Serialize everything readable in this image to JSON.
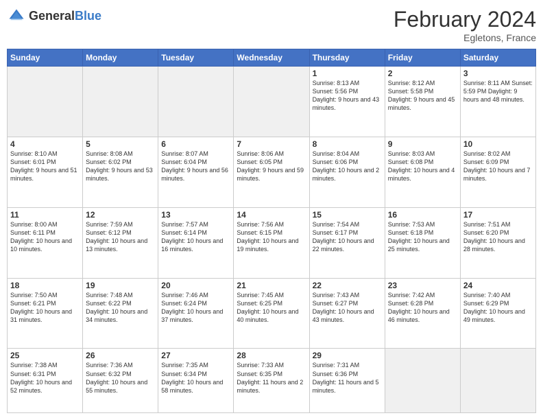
{
  "header": {
    "logo_general": "General",
    "logo_blue": "Blue",
    "month_title": "February 2024",
    "location": "Egletons, France"
  },
  "days_of_week": [
    "Sunday",
    "Monday",
    "Tuesday",
    "Wednesday",
    "Thursday",
    "Friday",
    "Saturday"
  ],
  "weeks": [
    [
      {
        "num": "",
        "info": ""
      },
      {
        "num": "",
        "info": ""
      },
      {
        "num": "",
        "info": ""
      },
      {
        "num": "",
        "info": ""
      },
      {
        "num": "1",
        "info": "Sunrise: 8:13 AM\nSunset: 5:56 PM\nDaylight: 9 hours\nand 43 minutes."
      },
      {
        "num": "2",
        "info": "Sunrise: 8:12 AM\nSunset: 5:58 PM\nDaylight: 9 hours\nand 45 minutes."
      },
      {
        "num": "3",
        "info": "Sunrise: 8:11 AM\nSunset: 5:59 PM\nDaylight: 9 hours\nand 48 minutes."
      }
    ],
    [
      {
        "num": "4",
        "info": "Sunrise: 8:10 AM\nSunset: 6:01 PM\nDaylight: 9 hours\nand 51 minutes."
      },
      {
        "num": "5",
        "info": "Sunrise: 8:08 AM\nSunset: 6:02 PM\nDaylight: 9 hours\nand 53 minutes."
      },
      {
        "num": "6",
        "info": "Sunrise: 8:07 AM\nSunset: 6:04 PM\nDaylight: 9 hours\nand 56 minutes."
      },
      {
        "num": "7",
        "info": "Sunrise: 8:06 AM\nSunset: 6:05 PM\nDaylight: 9 hours\nand 59 minutes."
      },
      {
        "num": "8",
        "info": "Sunrise: 8:04 AM\nSunset: 6:06 PM\nDaylight: 10 hours\nand 2 minutes."
      },
      {
        "num": "9",
        "info": "Sunrise: 8:03 AM\nSunset: 6:08 PM\nDaylight: 10 hours\nand 4 minutes."
      },
      {
        "num": "10",
        "info": "Sunrise: 8:02 AM\nSunset: 6:09 PM\nDaylight: 10 hours\nand 7 minutes."
      }
    ],
    [
      {
        "num": "11",
        "info": "Sunrise: 8:00 AM\nSunset: 6:11 PM\nDaylight: 10 hours\nand 10 minutes."
      },
      {
        "num": "12",
        "info": "Sunrise: 7:59 AM\nSunset: 6:12 PM\nDaylight: 10 hours\nand 13 minutes."
      },
      {
        "num": "13",
        "info": "Sunrise: 7:57 AM\nSunset: 6:14 PM\nDaylight: 10 hours\nand 16 minutes."
      },
      {
        "num": "14",
        "info": "Sunrise: 7:56 AM\nSunset: 6:15 PM\nDaylight: 10 hours\nand 19 minutes."
      },
      {
        "num": "15",
        "info": "Sunrise: 7:54 AM\nSunset: 6:17 PM\nDaylight: 10 hours\nand 22 minutes."
      },
      {
        "num": "16",
        "info": "Sunrise: 7:53 AM\nSunset: 6:18 PM\nDaylight: 10 hours\nand 25 minutes."
      },
      {
        "num": "17",
        "info": "Sunrise: 7:51 AM\nSunset: 6:20 PM\nDaylight: 10 hours\nand 28 minutes."
      }
    ],
    [
      {
        "num": "18",
        "info": "Sunrise: 7:50 AM\nSunset: 6:21 PM\nDaylight: 10 hours\nand 31 minutes."
      },
      {
        "num": "19",
        "info": "Sunrise: 7:48 AM\nSunset: 6:22 PM\nDaylight: 10 hours\nand 34 minutes."
      },
      {
        "num": "20",
        "info": "Sunrise: 7:46 AM\nSunset: 6:24 PM\nDaylight: 10 hours\nand 37 minutes."
      },
      {
        "num": "21",
        "info": "Sunrise: 7:45 AM\nSunset: 6:25 PM\nDaylight: 10 hours\nand 40 minutes."
      },
      {
        "num": "22",
        "info": "Sunrise: 7:43 AM\nSunset: 6:27 PM\nDaylight: 10 hours\nand 43 minutes."
      },
      {
        "num": "23",
        "info": "Sunrise: 7:42 AM\nSunset: 6:28 PM\nDaylight: 10 hours\nand 46 minutes."
      },
      {
        "num": "24",
        "info": "Sunrise: 7:40 AM\nSunset: 6:29 PM\nDaylight: 10 hours\nand 49 minutes."
      }
    ],
    [
      {
        "num": "25",
        "info": "Sunrise: 7:38 AM\nSunset: 6:31 PM\nDaylight: 10 hours\nand 52 minutes."
      },
      {
        "num": "26",
        "info": "Sunrise: 7:36 AM\nSunset: 6:32 PM\nDaylight: 10 hours\nand 55 minutes."
      },
      {
        "num": "27",
        "info": "Sunrise: 7:35 AM\nSunset: 6:34 PM\nDaylight: 10 hours\nand 58 minutes."
      },
      {
        "num": "28",
        "info": "Sunrise: 7:33 AM\nSunset: 6:35 PM\nDaylight: 11 hours\nand 2 minutes."
      },
      {
        "num": "29",
        "info": "Sunrise: 7:31 AM\nSunset: 6:36 PM\nDaylight: 11 hours\nand 5 minutes."
      },
      {
        "num": "",
        "info": ""
      },
      {
        "num": "",
        "info": ""
      }
    ]
  ]
}
